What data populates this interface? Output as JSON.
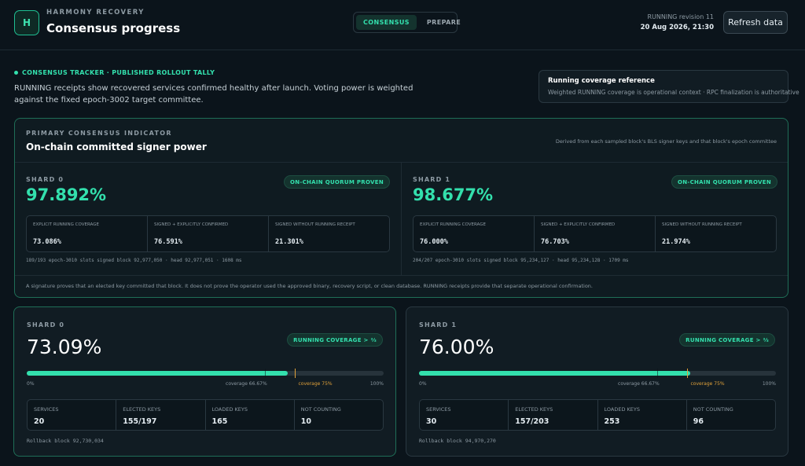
{
  "header": {
    "logo_letter": "H",
    "app_name": "HARMONY RECOVERY",
    "title": "Consensus progress",
    "tabs": [
      {
        "label": "CONSENSUS",
        "active": true
      },
      {
        "label": "PREPARE",
        "active": false
      }
    ],
    "revision": "RUNNING revision 11",
    "timestamp": "20 Aug 2026, 21:30",
    "refresh_label": "Refresh data"
  },
  "intro": {
    "tracker_label": "CONSENSUS TRACKER · PUBLISHED ROLLOUT TALLY",
    "text": "RUNNING receipts show recovered services confirmed healthy after launch. Voting power is weighted against the fixed epoch-3002 target committee."
  },
  "reference": {
    "title": "Running coverage reference",
    "subtitle": "Weighted RUNNING coverage is operational context · RPC finalization is authoritative"
  },
  "primary": {
    "label": "PRIMARY CONSENSUS INDICATOR",
    "title": "On-chain committed signer power",
    "note": "Derived from each sampled block's BLS signer keys and that block's epoch committee",
    "footer": "A signature proves that an elected key committed that block. It does not prove the operator used the approved binary, recovery script, or clean database. RUNNING receipts provide that separate operational confirmation.",
    "metric_labels": [
      "EXPLICIT RUNNING COVERAGE",
      "SIGNED + EXPLICITLY CONFIRMED",
      "SIGNED WITHOUT RUNNING RECEIPT"
    ],
    "shards": [
      {
        "label": "SHARD 0",
        "value": "97.892%",
        "badge": "ON-CHAIN QUORUM PROVEN",
        "metrics": [
          "73.086%",
          "76.591%",
          "21.301%"
        ],
        "footer": "189/193 epoch-3010 slots signed block 92,977,050 · head 92,977,051 · 1608 ms"
      },
      {
        "label": "SHARD 1",
        "value": "98.677%",
        "badge": "ON-CHAIN QUORUM PROVEN",
        "metrics": [
          "76.000%",
          "76.703%",
          "21.974%"
        ],
        "footer": "204/207 epoch-3010 slots signed block 95,234,127 · head 95,234,128 · 1709 ms"
      }
    ]
  },
  "coverage": {
    "tick_labels": {
      "start": "0%",
      "quorum": "coverage 66.67%",
      "target": "coverage 75%",
      "end": "100%"
    },
    "markers": {
      "quorum_pct": 66.67,
      "target_pct": 75
    },
    "stat_labels": [
      "SERVICES",
      "ELECTED KEYS",
      "LOADED KEYS",
      "NOT COUNTING"
    ],
    "colors": {
      "fill": "#33e0ad",
      "target_marker": "#e0a13a"
    },
    "cards": [
      {
        "label": "SHARD 0",
        "value": "73.09%",
        "progress_pct": 73.09,
        "badge": "RUNNING COVERAGE > ⅔",
        "stats": [
          "20",
          "155/197",
          "165",
          "10"
        ],
        "footer": "Rollback block 92,730,034"
      },
      {
        "label": "SHARD 1",
        "value": "76.00%",
        "progress_pct": 76.0,
        "badge": "RUNNING COVERAGE > ⅔",
        "stats": [
          "30",
          "157/203",
          "253",
          "96"
        ],
        "footer": "Rollback block 94,970,270"
      }
    ]
  }
}
